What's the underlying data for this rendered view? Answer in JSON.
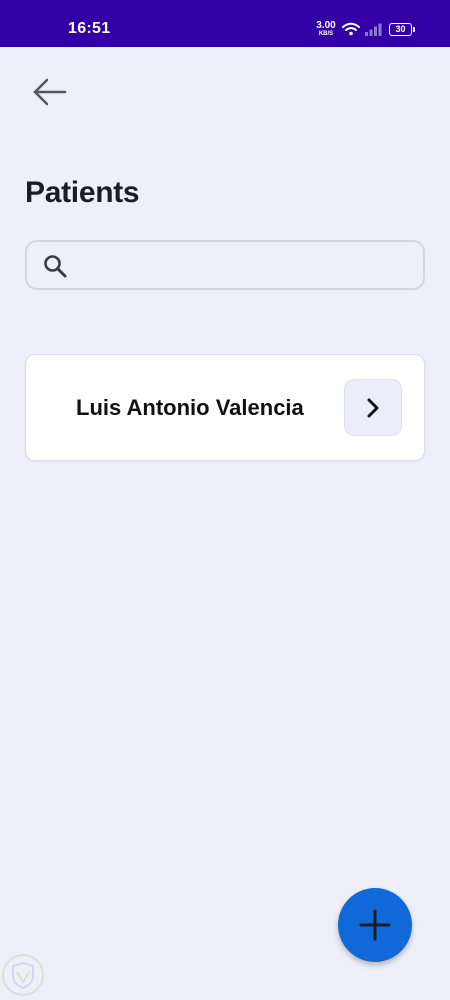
{
  "status_bar": {
    "time": "16:51",
    "net_speed_value": "3.00",
    "net_speed_unit": "KB/S",
    "battery_level": "30",
    "background_color": "#3300a6"
  },
  "header": {
    "back_icon": "arrow-left-icon"
  },
  "page": {
    "title": "Patients"
  },
  "search": {
    "icon": "search-icon",
    "value": "",
    "placeholder": ""
  },
  "patients": [
    {
      "name": "Luis Antonio Valencia",
      "action_icon": "chevron-right-icon"
    }
  ],
  "fab": {
    "icon": "plus-icon",
    "color": "#1168d8"
  },
  "colors": {
    "background": "#efeff9",
    "card": "#ffffff",
    "accent": "#1168d8"
  }
}
